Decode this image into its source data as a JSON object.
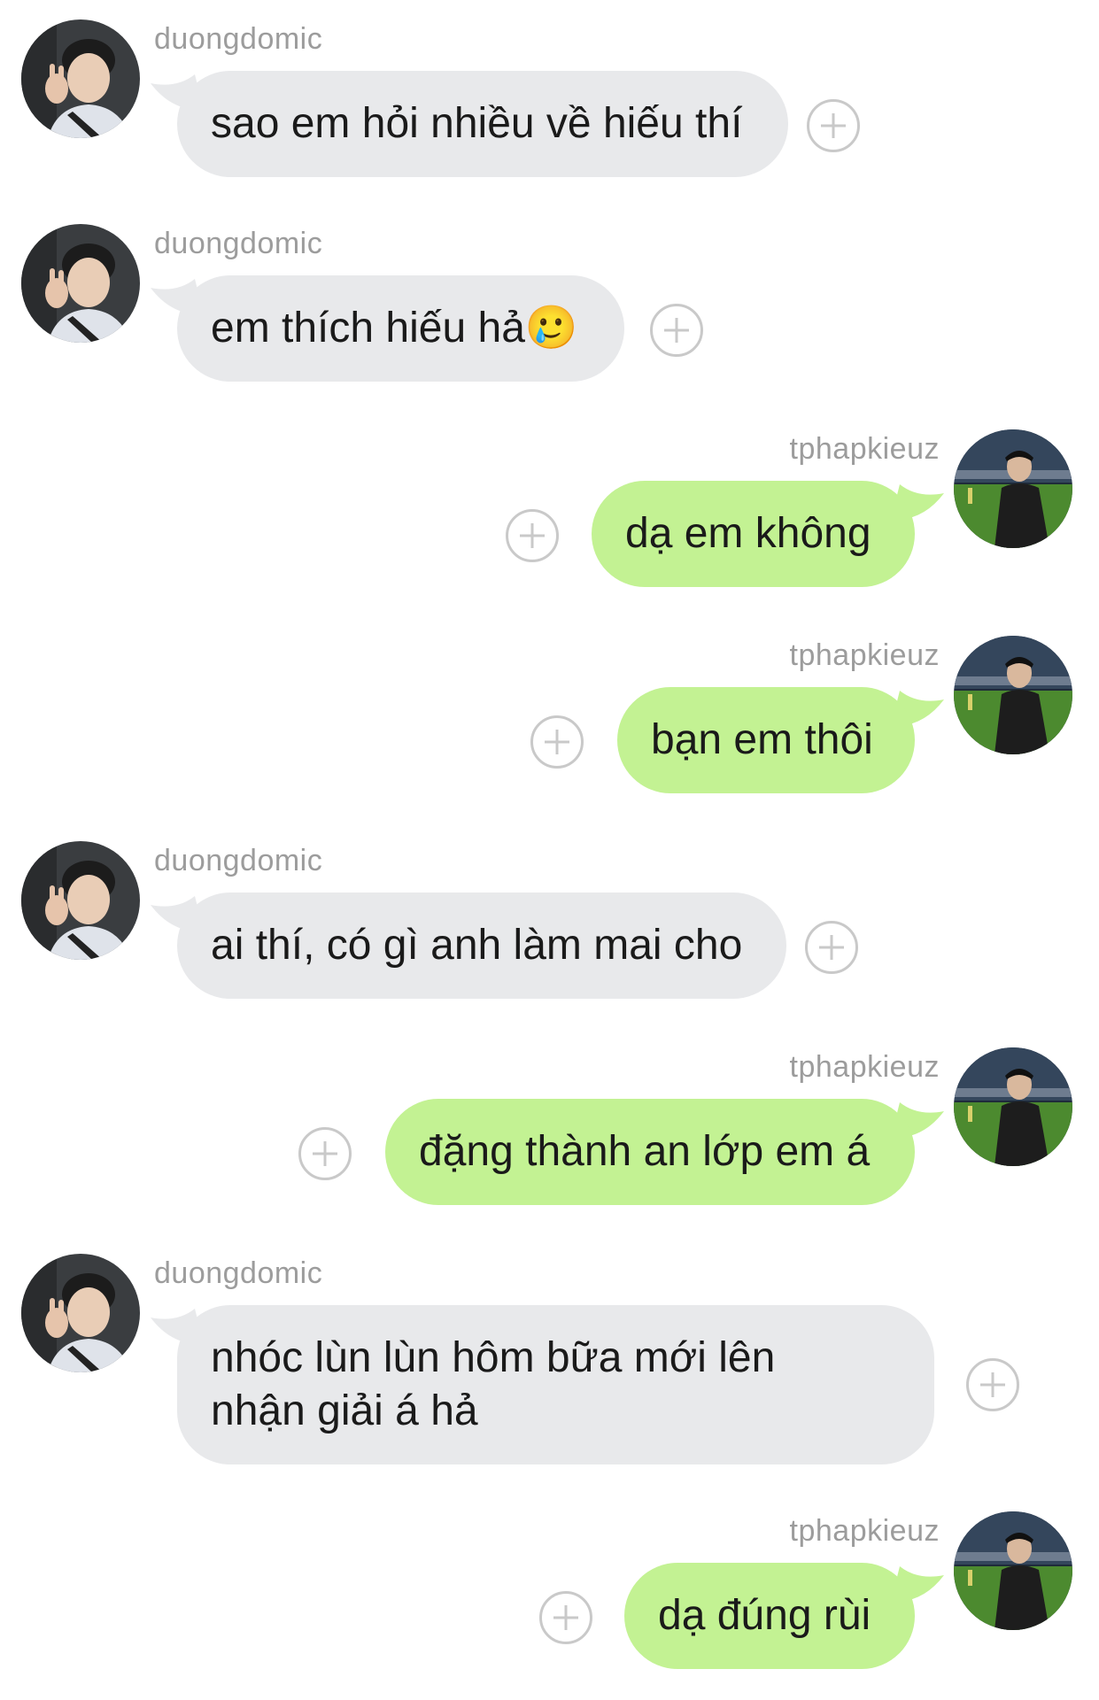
{
  "messages": [
    {
      "sender": "duongdomic",
      "text": "sao em hỏi nhiều về hiếu thí"
    },
    {
      "sender": "duongdomic",
      "text": "em thích hiếu hả🥲"
    },
    {
      "sender": "tphapkieuz",
      "text": "dạ em không"
    },
    {
      "sender": "tphapkieuz",
      "text": "bạn em thôi"
    },
    {
      "sender": "duongdomic",
      "text": "ai thí, có gì anh làm mai cho"
    },
    {
      "sender": "tphapkieuz",
      "text": "đặng thành an lớp em á"
    },
    {
      "sender": "duongdomic",
      "text": "nhóc lùn lùn hôm bữa mới lên nhận giải á hả"
    },
    {
      "sender": "tphapkieuz",
      "text": "dạ đúng rùi"
    }
  ],
  "icons": {
    "add_reaction": "plus-circle-icon",
    "avatar_duongdomic": "avatar-duongdomic",
    "avatar_tphapkieuz": "avatar-tphapkieuz"
  },
  "colors": {
    "incoming_bubble": "#e8e9eb",
    "outgoing_bubble": "#c3f293",
    "username": "#9c9c9c",
    "add_icon": "#c9c9c9"
  }
}
